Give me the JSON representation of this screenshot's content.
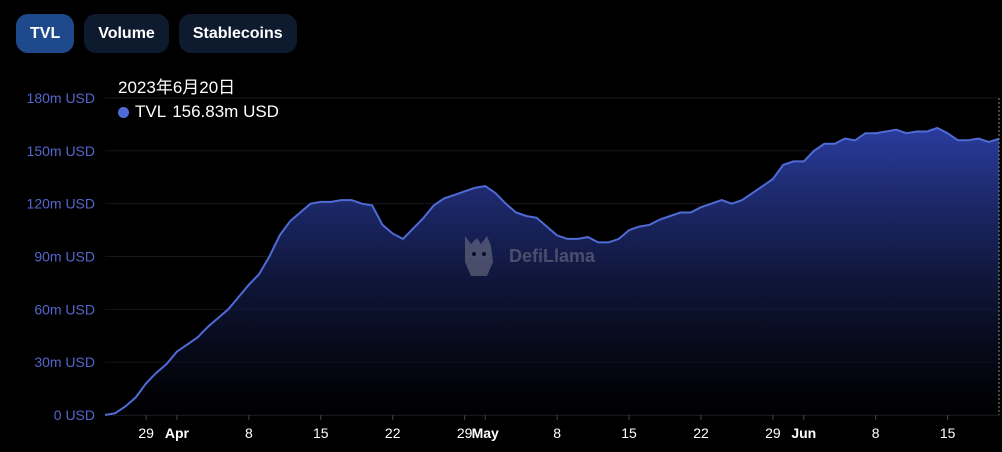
{
  "tabs": [
    {
      "label": "TVL",
      "active": true
    },
    {
      "label": "Volume",
      "active": false
    },
    {
      "label": "Stablecoins",
      "active": false
    }
  ],
  "tooltip": {
    "date": "2023年6月20日",
    "series": "TVL",
    "value": "156.83m USD"
  },
  "watermark": "DefiLlama",
  "colors": {
    "line": "#4f6bd6",
    "fill_top": "#2a3c9e",
    "fill_bottom": "#000000",
    "axis_text": "#5566cc"
  },
  "chart_data": {
    "type": "area",
    "title": "",
    "xlabel": "",
    "ylabel": "",
    "ylim": [
      0,
      180
    ],
    "yticks": [
      {
        "value": 0,
        "label": "0 USD"
      },
      {
        "value": 30,
        "label": "30m USD"
      },
      {
        "value": 60,
        "label": "60m USD"
      },
      {
        "value": 90,
        "label": "90m USD"
      },
      {
        "value": 120,
        "label": "120m USD"
      },
      {
        "value": 150,
        "label": "150m USD"
      },
      {
        "value": 180,
        "label": "180m USD"
      }
    ],
    "xlim": [
      "2023-03-25",
      "2023-06-20"
    ],
    "xticks": [
      {
        "date": "2023-03-29",
        "label": "29",
        "bold": false
      },
      {
        "date": "2023-04-01",
        "label": "Apr",
        "bold": true
      },
      {
        "date": "2023-04-08",
        "label": "8",
        "bold": false
      },
      {
        "date": "2023-04-15",
        "label": "15",
        "bold": false
      },
      {
        "date": "2023-04-22",
        "label": "22",
        "bold": false
      },
      {
        "date": "2023-04-29",
        "label": "29",
        "bold": false
      },
      {
        "date": "2023-05-01",
        "label": "May",
        "bold": true
      },
      {
        "date": "2023-05-08",
        "label": "8",
        "bold": false
      },
      {
        "date": "2023-05-15",
        "label": "15",
        "bold": false
      },
      {
        "date": "2023-05-22",
        "label": "22",
        "bold": false
      },
      {
        "date": "2023-05-29",
        "label": "29",
        "bold": false
      },
      {
        "date": "2023-06-01",
        "label": "Jun",
        "bold": true
      },
      {
        "date": "2023-06-08",
        "label": "8",
        "bold": false
      },
      {
        "date": "2023-06-15",
        "label": "15",
        "bold": false
      }
    ],
    "grid": true,
    "series": [
      {
        "name": "TVL",
        "points": [
          [
            "2023-03-25",
            0
          ],
          [
            "2023-03-26",
            1
          ],
          [
            "2023-03-27",
            5
          ],
          [
            "2023-03-28",
            10
          ],
          [
            "2023-03-29",
            18
          ],
          [
            "2023-03-30",
            24
          ],
          [
            "2023-03-31",
            29
          ],
          [
            "2023-04-01",
            36
          ],
          [
            "2023-04-02",
            40
          ],
          [
            "2023-04-03",
            44
          ],
          [
            "2023-04-04",
            50
          ],
          [
            "2023-04-05",
            55
          ],
          [
            "2023-04-06",
            60
          ],
          [
            "2023-04-07",
            67
          ],
          [
            "2023-04-08",
            74
          ],
          [
            "2023-04-09",
            80
          ],
          [
            "2023-04-10",
            90
          ],
          [
            "2023-04-11",
            102
          ],
          [
            "2023-04-12",
            110
          ],
          [
            "2023-04-13",
            115
          ],
          [
            "2023-04-14",
            120
          ],
          [
            "2023-04-15",
            121
          ],
          [
            "2023-04-16",
            121
          ],
          [
            "2023-04-17",
            122
          ],
          [
            "2023-04-18",
            122
          ],
          [
            "2023-04-19",
            120
          ],
          [
            "2023-04-20",
            119
          ],
          [
            "2023-04-21",
            108
          ],
          [
            "2023-04-22",
            103
          ],
          [
            "2023-04-23",
            100
          ],
          [
            "2023-04-24",
            106
          ],
          [
            "2023-04-25",
            112
          ],
          [
            "2023-04-26",
            119
          ],
          [
            "2023-04-27",
            123
          ],
          [
            "2023-04-28",
            125
          ],
          [
            "2023-04-29",
            127
          ],
          [
            "2023-04-30",
            129
          ],
          [
            "2023-05-01",
            130
          ],
          [
            "2023-05-02",
            126
          ],
          [
            "2023-05-03",
            120
          ],
          [
            "2023-05-04",
            115
          ],
          [
            "2023-05-05",
            113
          ],
          [
            "2023-05-06",
            112
          ],
          [
            "2023-05-07",
            107
          ],
          [
            "2023-05-08",
            102
          ],
          [
            "2023-05-09",
            100
          ],
          [
            "2023-05-10",
            100
          ],
          [
            "2023-05-11",
            101
          ],
          [
            "2023-05-12",
            98
          ],
          [
            "2023-05-13",
            98
          ],
          [
            "2023-05-14",
            100
          ],
          [
            "2023-05-15",
            105
          ],
          [
            "2023-05-16",
            107
          ],
          [
            "2023-05-17",
            108
          ],
          [
            "2023-05-18",
            111
          ],
          [
            "2023-05-19",
            113
          ],
          [
            "2023-05-20",
            115
          ],
          [
            "2023-05-21",
            115
          ],
          [
            "2023-05-22",
            118
          ],
          [
            "2023-05-23",
            120
          ],
          [
            "2023-05-24",
            122
          ],
          [
            "2023-05-25",
            120
          ],
          [
            "2023-05-26",
            122
          ],
          [
            "2023-05-27",
            126
          ],
          [
            "2023-05-28",
            130
          ],
          [
            "2023-05-29",
            134
          ],
          [
            "2023-05-30",
            142
          ],
          [
            "2023-05-31",
            144
          ],
          [
            "2023-06-01",
            144
          ],
          [
            "2023-06-02",
            150
          ],
          [
            "2023-06-03",
            154
          ],
          [
            "2023-06-04",
            154
          ],
          [
            "2023-06-05",
            157
          ],
          [
            "2023-06-06",
            156
          ],
          [
            "2023-06-07",
            160
          ],
          [
            "2023-06-08",
            160
          ],
          [
            "2023-06-09",
            161
          ],
          [
            "2023-06-10",
            162
          ],
          [
            "2023-06-11",
            160
          ],
          [
            "2023-06-12",
            161
          ],
          [
            "2023-06-13",
            161
          ],
          [
            "2023-06-14",
            163
          ],
          [
            "2023-06-15",
            160
          ],
          [
            "2023-06-16",
            156
          ],
          [
            "2023-06-17",
            156
          ],
          [
            "2023-06-18",
            157
          ],
          [
            "2023-06-19",
            155
          ],
          [
            "2023-06-20",
            156.83
          ]
        ]
      }
    ]
  }
}
